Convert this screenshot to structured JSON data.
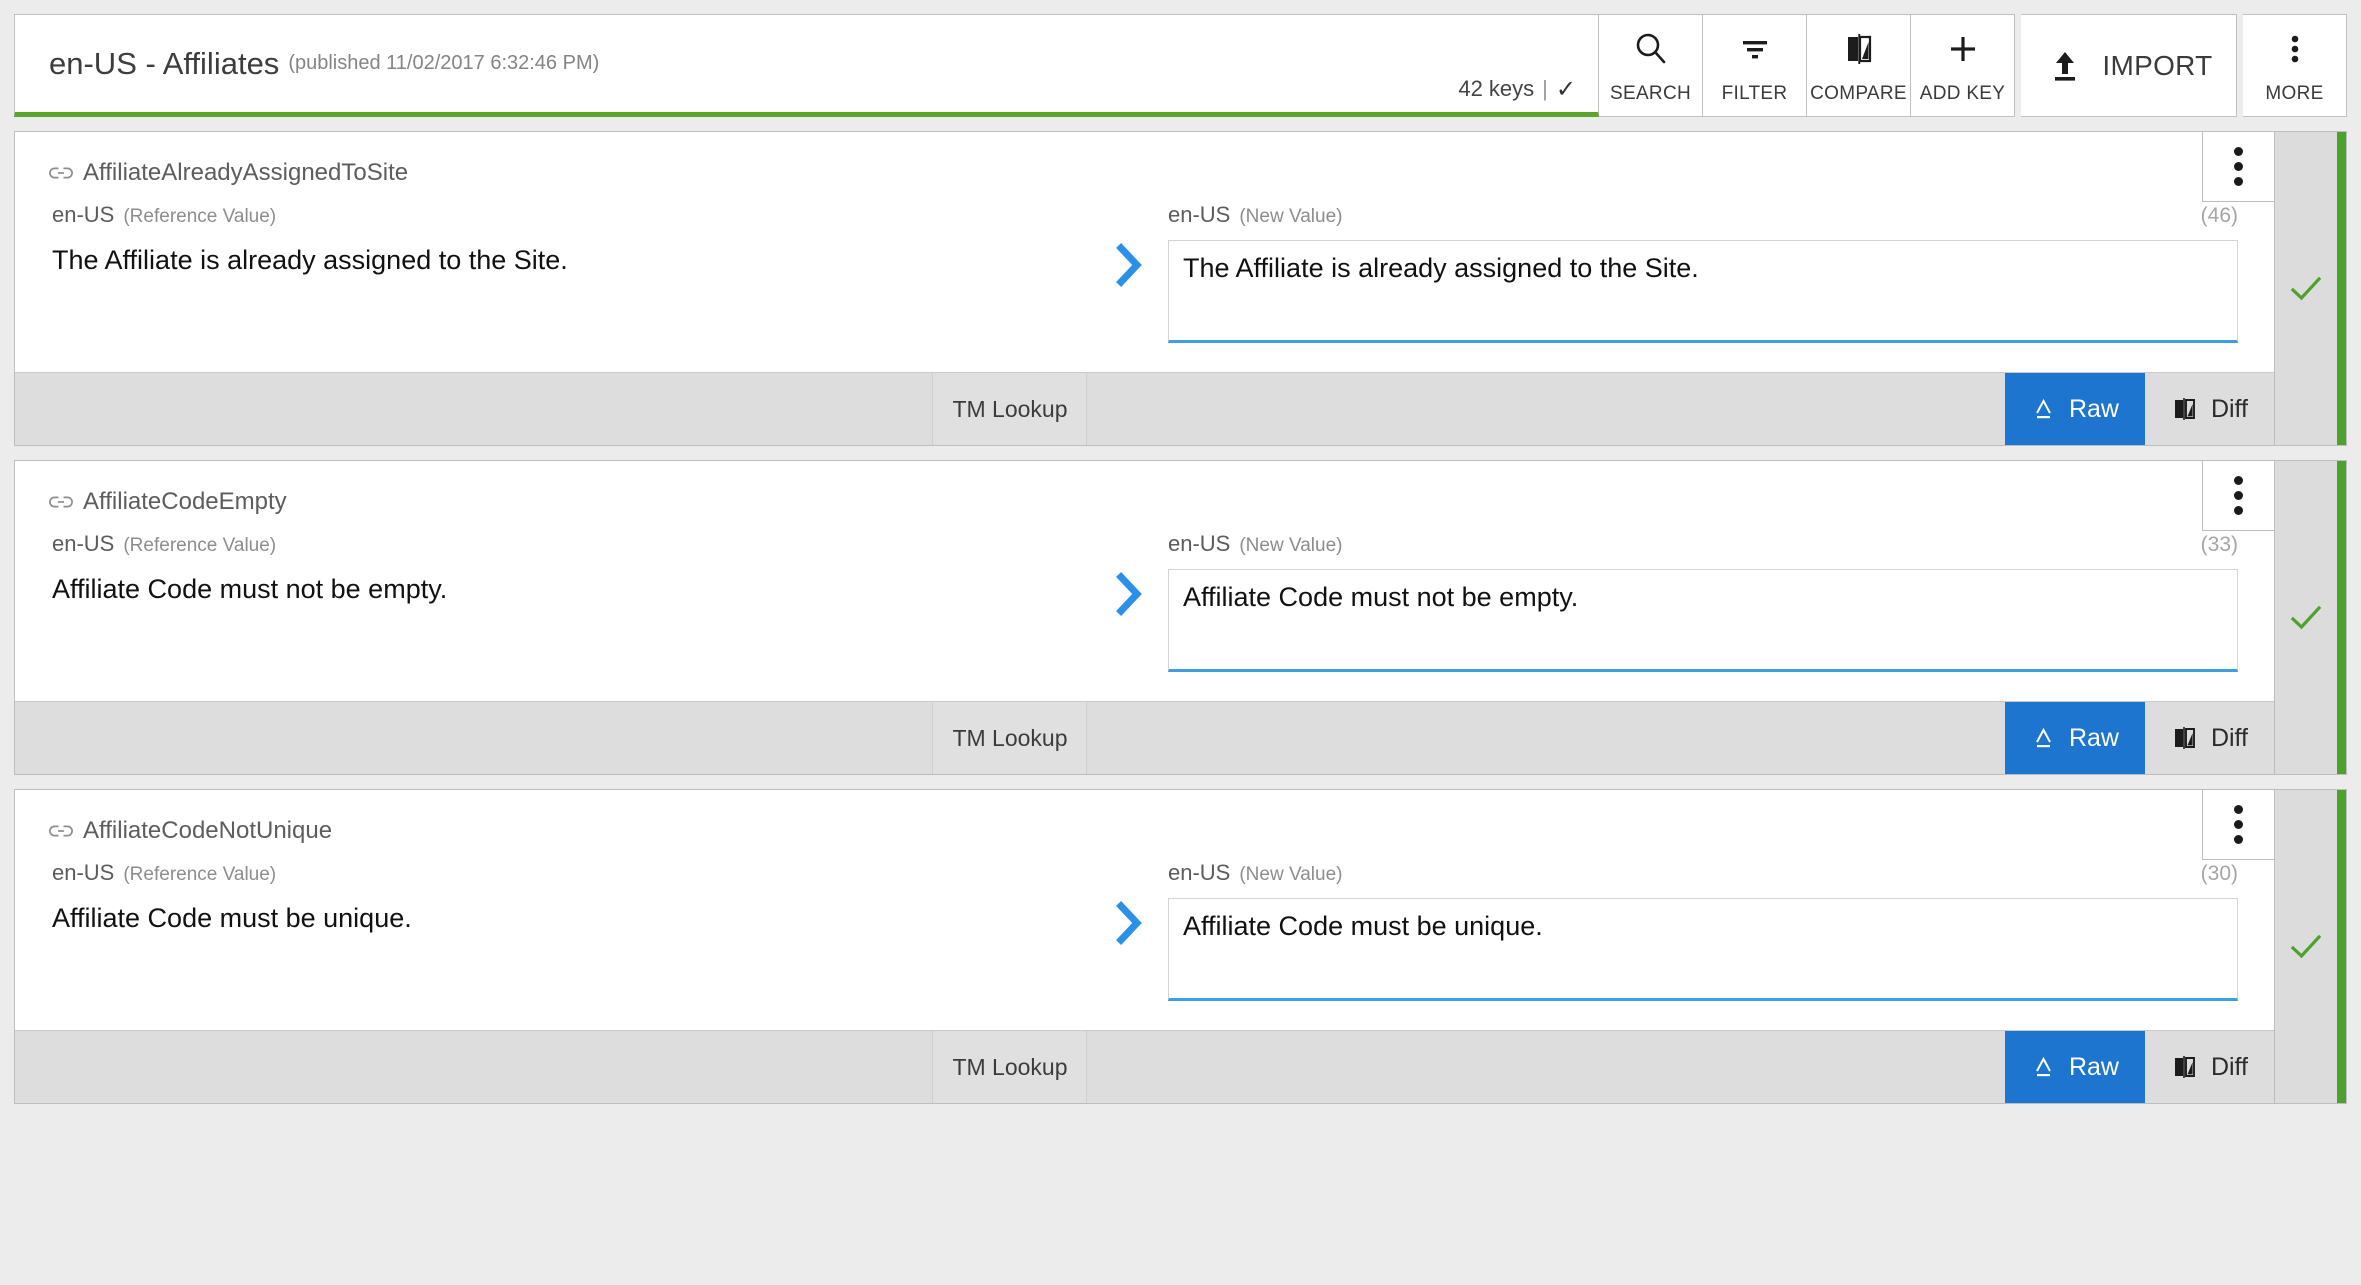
{
  "header": {
    "title": "en-US - Affiliates",
    "published": "(published 11/02/2017 6:32:46 PM)",
    "keys_count": "42 keys",
    "keys_divider": "|",
    "keys_check": "✓",
    "accent_green": "#5aa52b",
    "toolbar": [
      {
        "id": "search",
        "label": "SEARCH",
        "icon": "search-icon"
      },
      {
        "id": "filter",
        "label": "FILTER",
        "icon": "filter-icon"
      },
      {
        "id": "compare",
        "label": "COMPARE",
        "icon": "compare-icon"
      },
      {
        "id": "add-key",
        "label": "ADD KEY",
        "icon": "plus-icon"
      },
      {
        "id": "import",
        "label": "IMPORT",
        "icon": "upload-icon"
      },
      {
        "id": "more",
        "label": "MORE",
        "icon": "kebab-icon"
      }
    ]
  },
  "colors": {
    "accent_blue": "#1d75cf",
    "chevron_blue": "#2b90e8",
    "status_green": "#4ca22d",
    "underline_blue": "#3b9fe0",
    "page_background": "#ececec"
  },
  "footer_labels": {
    "tm_lookup": "TM Lookup",
    "raw": "Raw",
    "diff": "Diff"
  },
  "labels": {
    "reference_lang": "en-US",
    "reference_note": "(Reference Value)",
    "new_lang": "en-US",
    "new_note": "(New Value)"
  },
  "rows": [
    {
      "key": "AffiliateAlreadyAssignedToSite",
      "reference_lang": "en-US",
      "reference_note": "(Reference Value)",
      "reference_value": "The Affiliate is already assigned to the Site.",
      "new_lang": "en-US",
      "new_note": "(New Value)",
      "new_value": "The Affiliate is already assigned to the Site.",
      "char_count": "(46)",
      "status": "✓",
      "raw_active": true
    },
    {
      "key": "AffiliateCodeEmpty",
      "reference_lang": "en-US",
      "reference_note": "(Reference Value)",
      "reference_value": "Affiliate Code must not be empty.",
      "new_lang": "en-US",
      "new_note": "(New Value)",
      "new_value": "Affiliate Code must not be empty.",
      "char_count": "(33)",
      "status": "✓",
      "raw_active": true
    },
    {
      "key": "AffiliateCodeNotUnique",
      "reference_lang": "en-US",
      "reference_note": "(Reference Value)",
      "reference_value": "Affiliate Code must be unique.",
      "new_lang": "en-US",
      "new_note": "(New Value)",
      "new_value": "Affiliate Code must be unique.",
      "char_count": "(30)",
      "status": "✓",
      "raw_active": true
    }
  ]
}
